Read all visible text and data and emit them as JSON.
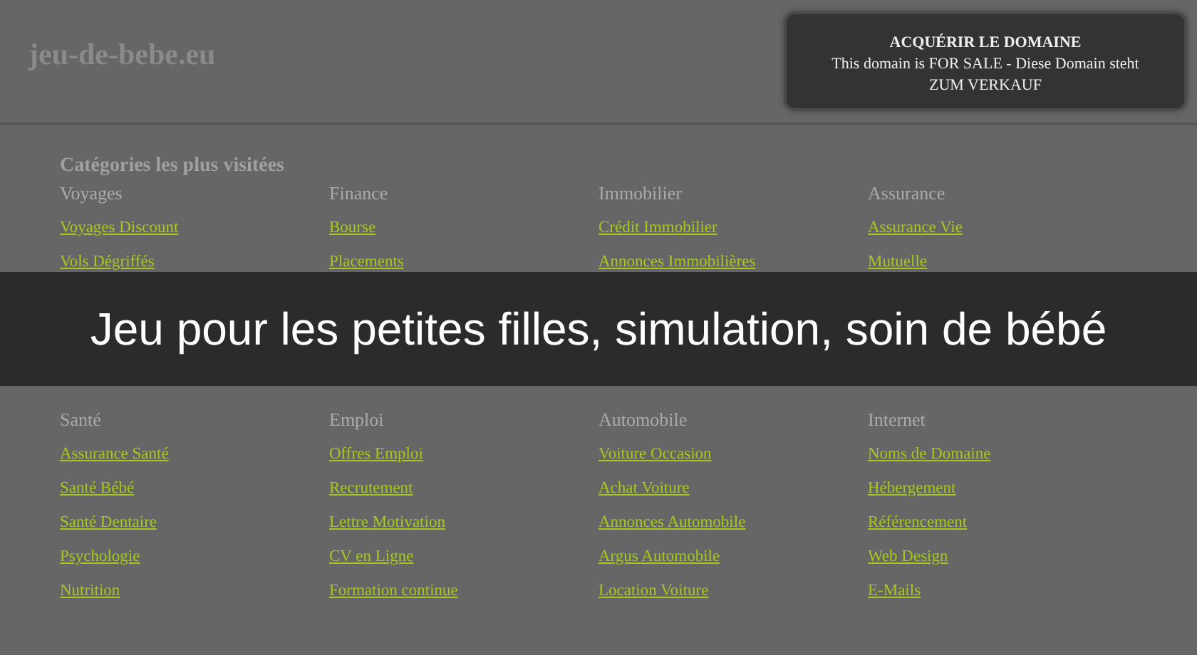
{
  "header": {
    "logo": "jeu-de-bebe.eu",
    "sale_box": {
      "title": "ACQUÉRIR LE DOMAINE",
      "text": "This domain is FOR SALE - Diese Domain steht ZUM VERKAUF"
    }
  },
  "directory": {
    "title": "Catégories les plus visitées",
    "sections": [
      {
        "categories": [
          {
            "name": "Voyages",
            "links": [
              "Voyages Discount",
              "Vols Dégriffés"
            ]
          },
          {
            "name": "Finance",
            "links": [
              "Bourse",
              "Placements"
            ]
          },
          {
            "name": "Immobilier",
            "links": [
              "Crédit Immobilier",
              "Annonces Immobilières"
            ]
          },
          {
            "name": "Assurance",
            "links": [
              "Assurance Vie",
              "Mutuelle"
            ]
          }
        ]
      },
      {
        "categories": [
          {
            "name": "Santé",
            "links": [
              "Assurance Santé",
              "Santé Bébé",
              "Santé Dentaire",
              "Psychologie",
              "Nutrition"
            ]
          },
          {
            "name": "Emploi",
            "links": [
              "Offres Emploi",
              "Recrutement",
              "Lettre Motivation",
              "CV en Ligne",
              "Formation continue"
            ]
          },
          {
            "name": "Automobile",
            "links": [
              "Voiture Occasion",
              "Achat Voiture",
              "Annonces Automobile",
              "Argus Automobile",
              "Location Voiture"
            ]
          },
          {
            "name": "Internet",
            "links": [
              "Noms de Domaine",
              "Hébergement",
              "Référencement",
              "Web Design",
              "E-Mails"
            ]
          }
        ]
      }
    ]
  },
  "banner": {
    "title": "Jeu pour les petites filles, simulation, soin de bébé"
  }
}
